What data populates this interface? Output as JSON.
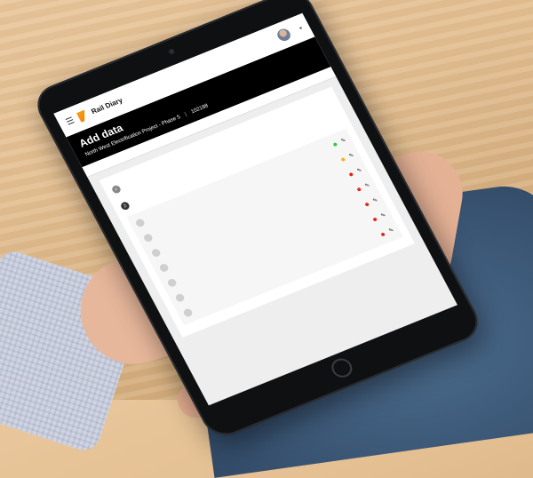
{
  "app": {
    "menu_icon": "menu-icon",
    "logo_text": "Rail Diary",
    "logo_sub": "",
    "user_name": "",
    "user_role": ""
  },
  "header": {
    "title": "Add data",
    "project": "North West Electrification Project - Phase 5",
    "project_code": "102188"
  },
  "info_bar": "",
  "panel": {
    "top_link": "",
    "steps": [
      {
        "num": "✓",
        "label": "",
        "state": "done"
      },
      {
        "num": "2",
        "label": "",
        "state": "active"
      }
    ],
    "sub_rows": [
      {
        "label": "",
        "status_color": "#2ecc40",
        "icon": "pencil-icon"
      },
      {
        "label": "",
        "status_color": "#f5b21b",
        "icon": "pencil-icon"
      },
      {
        "label": "",
        "status_color": "#e3261b",
        "icon": "pencil-icon"
      },
      {
        "label": "",
        "status_color": "#e3261b",
        "icon": "pencil-icon"
      },
      {
        "label": "",
        "status_color": "#e3261b",
        "icon": "pencil-icon"
      },
      {
        "label": "",
        "status_color": "#e3261b",
        "icon": "pencil-icon"
      },
      {
        "label": "",
        "status_color": "#e3261b",
        "icon": "pencil-icon"
      }
    ]
  },
  "colors": {
    "brand_orange": "#f6a21a",
    "header_bg": "#000000",
    "status_green": "#2ecc40",
    "status_amber": "#f5b21b",
    "status_red": "#e3261b"
  }
}
